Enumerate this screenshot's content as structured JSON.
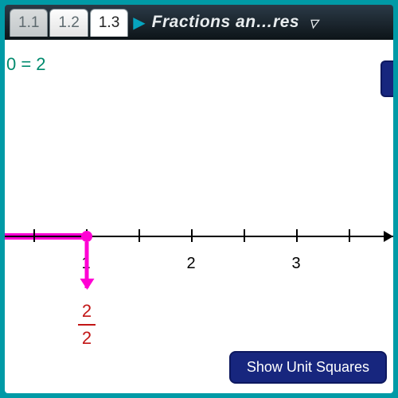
{
  "header": {
    "tabs": [
      {
        "label": "1.1",
        "active": false,
        "hidden": true
      },
      {
        "label": "1.2",
        "active": false,
        "hidden": false
      },
      {
        "label": "1.3",
        "active": true,
        "hidden": false
      }
    ],
    "title": "Fractions an…res"
  },
  "equation": "0 = 2",
  "axis": {
    "labels": [
      "1",
      "2",
      "3"
    ],
    "pointer_fraction": {
      "num": "2",
      "den": "2"
    }
  },
  "button": {
    "show_unit_squares": "Show Unit Squares"
  },
  "colors": {
    "accent": "#009aa6",
    "magenta": "#ff00d4",
    "teal_text": "#008a6e",
    "btn": "#17267e"
  }
}
